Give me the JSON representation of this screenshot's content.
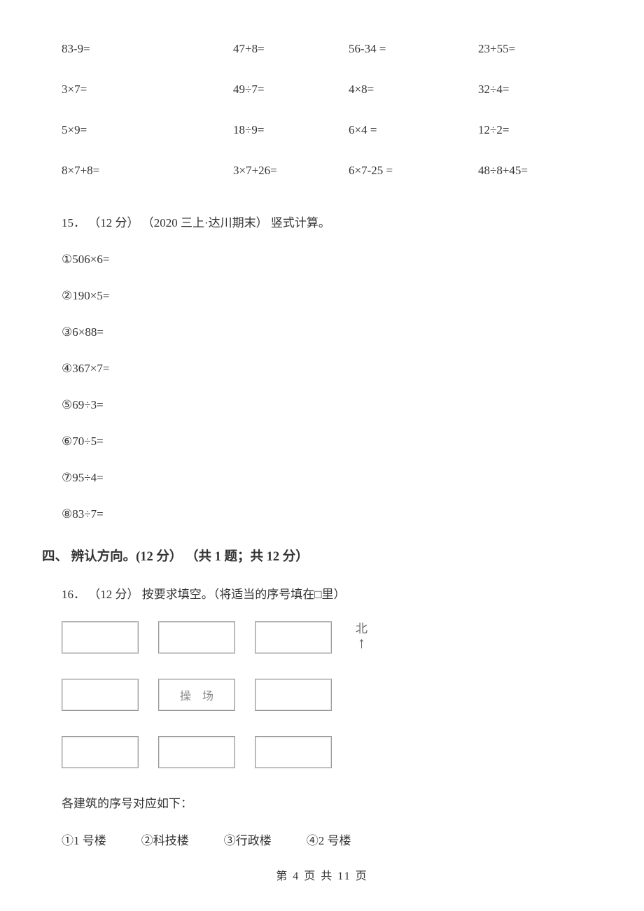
{
  "math_rows": [
    [
      "83-9=",
      "47+8=",
      "56-34 =",
      "23+55="
    ],
    [
      "3×7=",
      "49÷7=",
      "4×8=",
      "32÷4="
    ],
    [
      "5×9=",
      "18÷9=",
      "6×4 =",
      "12÷2="
    ],
    [
      "8×7+8=",
      "3×7+26=",
      "6×7-25 =",
      "48÷8+45="
    ]
  ],
  "q15": {
    "header": "15． （12 分） （2020 三上·达川期末） 竖式计算。",
    "items": [
      "①506×6=",
      "②190×5=",
      "③6×88=",
      "④367×7=",
      "⑤69÷3=",
      "⑥70÷5=",
      "⑦95÷4=",
      "⑧83÷7="
    ]
  },
  "section4": {
    "title": "四、 辨认方向。(12 分） （共 1 题；共 12 分）"
  },
  "q16": {
    "header": "16． （12 分） 按要求填空。（将适当的序号填在□里）",
    "map_center": "操场",
    "north_label": "北",
    "legend_title": "各建筑的序号对应如下：",
    "legend_items": [
      "①1 号楼",
      "②科技楼",
      "③行政楼",
      "④2 号楼"
    ]
  },
  "footer": "第 4 页 共 11 页"
}
